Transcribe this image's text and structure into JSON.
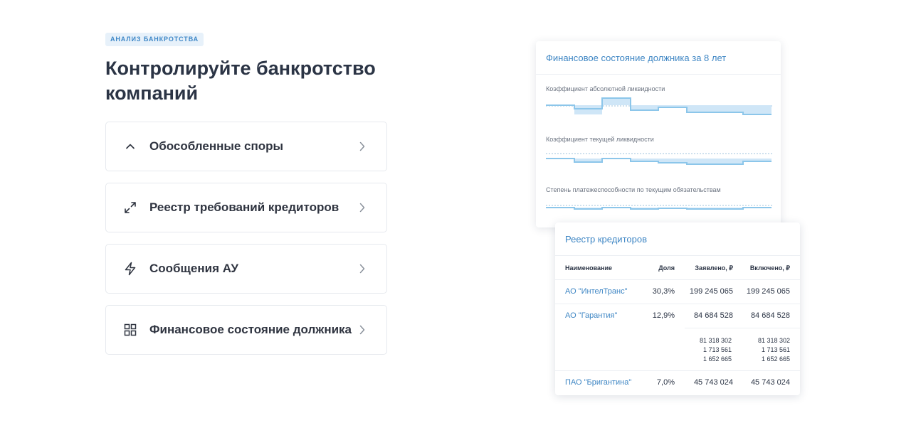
{
  "badge": "АНАЛИЗ БАНКРОТСТВА",
  "title": "Контролируйте банкротство компаний",
  "features": [
    {
      "label": "Обособленные споры",
      "icon": "chevron-up-icon"
    },
    {
      "label": "Реестр требований кредиторов",
      "icon": "expand-arrows-icon"
    },
    {
      "label": "Сообщения АУ",
      "icon": "lightning-icon"
    },
    {
      "label": "Финансовое состояние должника",
      "icon": "grid-icon"
    }
  ],
  "finance_panel": {
    "title": "Финансовое состояние должника за 8 лет",
    "metrics": [
      {
        "label": "Коэффициент абсолютной ликвидности"
      },
      {
        "label": "Коэффициент текущей ликвидности"
      },
      {
        "label": "Степень платежеспособности по текущим обязательствам"
      }
    ]
  },
  "registry_panel": {
    "title": "Реестр кредиторов",
    "columns": [
      "Наименование",
      "Доля",
      "Заявлено, ₽",
      "Включено, ₽"
    ],
    "rows": [
      {
        "name": "АО \"ИнтелТранс\"",
        "share": "30,3%",
        "declared": "199 245 065",
        "included": "199 245 065"
      },
      {
        "name": "АО \"Гарантия\"",
        "share": "12,9%",
        "declared": "84 684 528",
        "included": "84 684 528"
      },
      {
        "name": "",
        "share": "",
        "declared": "81 318 302",
        "included": "81 318 302"
      },
      {
        "name": "",
        "share": "",
        "declared": "1 713 561",
        "included": "1 713 561"
      },
      {
        "name": "",
        "share": "",
        "declared": "1 652 665",
        "included": "1 652 665"
      },
      {
        "name": "ПАО \"Бригантина\"",
        "share": "7,0%",
        "declared": "45 743 024",
        "included": "45 743 024"
      }
    ]
  },
  "colors": {
    "accent": "#3e86c4",
    "chart_fill": "#cfe6f7",
    "chart_line": "#8cc6ea"
  }
}
